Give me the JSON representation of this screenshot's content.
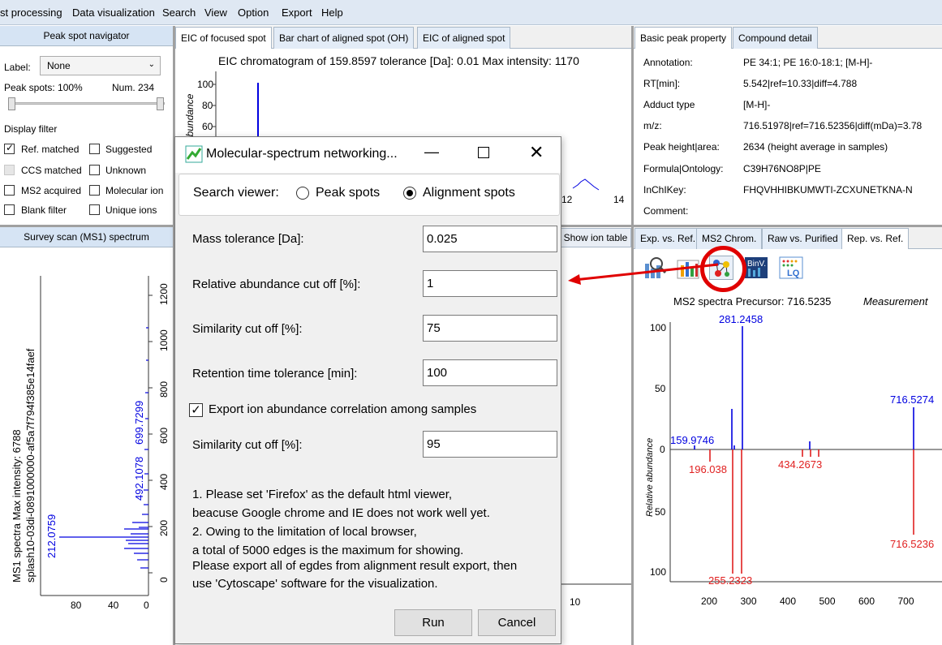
{
  "menu": [
    "st processing",
    "Data visualization",
    "Search",
    "View",
    "Option",
    "Export",
    "Help"
  ],
  "navigator": {
    "title": "Peak spot navigator",
    "label_caption": "Label:",
    "label_value": "None",
    "peak_spots": "Peak spots: 100%",
    "num": "Num. 234",
    "display_filter": "Display filter",
    "filters": [
      {
        "label": "Ref. matched",
        "checked": true,
        "disabled": false
      },
      {
        "label": "Suggested",
        "checked": false,
        "disabled": false
      },
      {
        "label": "CCS matched",
        "checked": false,
        "disabled": true
      },
      {
        "label": "Unknown",
        "checked": false,
        "disabled": false
      },
      {
        "label": "MS2 acquired",
        "checked": false,
        "disabled": false
      },
      {
        "label": "Molecular ion",
        "checked": false,
        "disabled": false
      },
      {
        "label": "Blank filter",
        "checked": false,
        "disabled": false
      },
      {
        "label": "Unique ions",
        "checked": false,
        "disabled": false
      }
    ]
  },
  "eic_tabs": [
    "EIC of focused spot",
    "Bar chart of aligned spot (OH)",
    "EIC of aligned spot"
  ],
  "eic": {
    "title": "EIC chromatogram of 159.8597 tolerance [Da]: 0.01  Max intensity: 1170",
    "ylabel": "abundance",
    "y_ticks": [
      "100",
      "80",
      "60"
    ],
    "x_ticks": [
      "12",
      "14"
    ]
  },
  "survey": {
    "title": "Survey scan (MS1) spectrum",
    "side_label_1": "MS1 spectra Max intensity: 6788",
    "side_label_2": "splash10-03di-0891000000-af5a7f794f385e14faef",
    "peaks": [
      "212.0759",
      "492.1078",
      "699.7299"
    ],
    "y_ticks": [
      "1200",
      "1000",
      "800",
      "600",
      "400",
      "200",
      "0"
    ],
    "x_ticks": [
      "80",
      "40",
      "0"
    ],
    "bottom_tick": "10",
    "show_ion_table": "Show ion table"
  },
  "property_tabs": [
    "Basic peak property",
    "Compound detail"
  ],
  "properties": [
    {
      "key": "Annotation:",
      "value": "PE 34:1; PE 16:0-18:1; [M-H]-"
    },
    {
      "key": "RT[min]:",
      "value": "5.542|ref=10.33|diff=4.788"
    },
    {
      "key": "Adduct type",
      "value": "[M-H]-"
    },
    {
      "key": "m/z:",
      "value": "716.51978|ref=716.52356|diff(mDa)=3.78"
    },
    {
      "key": "Peak height|area:",
      "value": "2634 (height average in samples)"
    },
    {
      "key": "Formula|Ontology:",
      "value": "C39H76NO8P|PE"
    },
    {
      "key": "InChIKey:",
      "value": "FHQVHHIBKUMWTI-ZCXUNETKNA-N"
    },
    {
      "key": "Comment:",
      "value": ""
    }
  ],
  "ms2_tabs": [
    "Exp. vs. Ref.",
    "MS2 Chrom.",
    "Raw vs. Purified",
    "Rep. vs. Ref."
  ],
  "ms2_toolbar_icons": [
    "search-icon",
    "bar-chart-icon",
    "network-icon",
    "bin-icon",
    "lq-icon"
  ],
  "ms2": {
    "title": "MS2 spectra Precursor: 716.5235",
    "measurement": "Measurement",
    "ylabel": "Relative abundance",
    "top_labels": [
      "281.2458",
      "159.9746",
      "716.5274"
    ],
    "bottom_labels": [
      "196.038",
      "434.2673",
      "255.2323",
      "716.5236"
    ],
    "y_ticks_top": [
      "100",
      "50",
      "0"
    ],
    "y_ticks_bottom": [
      "50",
      "100"
    ],
    "x_ticks": [
      "200",
      "300",
      "400",
      "500",
      "600",
      "700"
    ]
  },
  "dialog": {
    "title": "Molecular-spectrum networking...",
    "search_viewer_label": "Search viewer:",
    "radio_options": [
      {
        "label": "Peak spots",
        "selected": false
      },
      {
        "label": "Alignment spots",
        "selected": true
      }
    ],
    "fields": [
      {
        "label": "Mass tolerance [Da]:",
        "value": "0.025"
      },
      {
        "label": "Relative abundance cut off [%]:",
        "value": "1"
      },
      {
        "label": "Similarity cut off [%]:",
        "value": "75"
      },
      {
        "label": "Retention time tolerance [min]:",
        "value": "100"
      }
    ],
    "export_checkbox": {
      "label": "Export ion abundance correlation among samples",
      "checked": true
    },
    "similarity2": {
      "label": "Similarity cut off [%]:",
      "value": "95"
    },
    "notes": [
      "1. Please set 'Firefox' as the default html viewer,",
      "beacuse Google chrome and IE does not work well yet.",
      "2. Owing to the limitation of local browser,",
      "a total of 5000 edges is the maximum for showing.",
      "Please export all of egdes from alignment result export, then",
      "use 'Cytoscape' software for the visualization."
    ],
    "run": "Run",
    "cancel": "Cancel"
  },
  "colors": {
    "accent_red": "#e00000",
    "spectrum_blue": "#0000e0",
    "spectrum_red": "#e02020"
  }
}
